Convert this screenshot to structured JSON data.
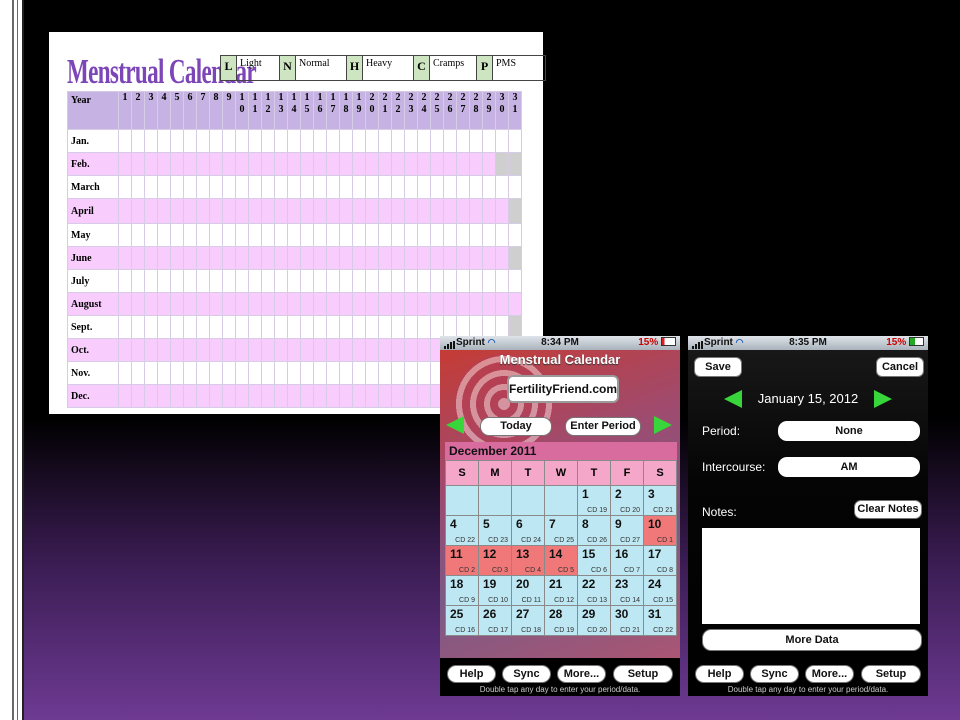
{
  "paper": {
    "title": "Menstrual Calendar",
    "legend": [
      {
        "code": "L",
        "label": "Light"
      },
      {
        "code": "N",
        "label": "Normal"
      },
      {
        "code": "H",
        "label": "Heavy"
      },
      {
        "code": "C",
        "label": "Cramps"
      },
      {
        "code": "P",
        "label": "PMS"
      }
    ],
    "year_label": "Year",
    "days": [
      "1",
      "2",
      "3",
      "4",
      "5",
      "6",
      "7",
      "8",
      "9",
      "1\n0",
      "1\n1",
      "1\n2",
      "1\n3",
      "1\n4",
      "1\n5",
      "1\n6",
      "1\n7",
      "1\n8",
      "1\n9",
      "2\n0",
      "2\n1",
      "2\n2",
      "2\n3",
      "2\n4",
      "2\n5",
      "2\n6",
      "2\n7",
      "2\n8",
      "2\n9",
      "3\n0",
      "3\n1"
    ],
    "months": [
      {
        "name": "Jan.",
        "shade": "white",
        "days_in_month": 31
      },
      {
        "name": "Feb.",
        "shade": "pink",
        "days_in_month": 29
      },
      {
        "name": "March",
        "shade": "white",
        "days_in_month": 31
      },
      {
        "name": "April",
        "shade": "pink",
        "days_in_month": 30
      },
      {
        "name": "May",
        "shade": "white",
        "days_in_month": 31
      },
      {
        "name": "June",
        "shade": "pink",
        "days_in_month": 30
      },
      {
        "name": "July",
        "shade": "white",
        "days_in_month": 31
      },
      {
        "name": "August",
        "shade": "pink",
        "days_in_month": 31
      },
      {
        "name": "Sept.",
        "shade": "white",
        "days_in_month": 30
      },
      {
        "name": "Oct.",
        "shade": "pink",
        "days_in_month": 31
      },
      {
        "name": "Nov.",
        "shade": "white",
        "days_in_month": 30
      },
      {
        "name": "Dec.",
        "shade": "pink",
        "days_in_month": 31
      }
    ]
  },
  "phone1": {
    "carrier": "Sprint",
    "time": "8:34 PM",
    "battery": "15%",
    "app_title": "Menstrual Calendar",
    "logo": "FertilityFriend.com",
    "today_label": "Today",
    "enter_period_label": "Enter Period",
    "month_title": "December 2011",
    "weekdays": [
      "S",
      "M",
      "T",
      "W",
      "T",
      "F",
      "S"
    ],
    "leading_blanks": 4,
    "days": [
      {
        "n": "1",
        "cd": "CD 19",
        "red": false
      },
      {
        "n": "2",
        "cd": "CD 20",
        "red": false
      },
      {
        "n": "3",
        "cd": "CD 21",
        "red": false
      },
      {
        "n": "4",
        "cd": "CD 22",
        "red": false
      },
      {
        "n": "5",
        "cd": "CD 23",
        "red": false
      },
      {
        "n": "6",
        "cd": "CD 24",
        "red": false
      },
      {
        "n": "7",
        "cd": "CD 25",
        "red": false
      },
      {
        "n": "8",
        "cd": "CD 26",
        "red": false
      },
      {
        "n": "9",
        "cd": "CD 27",
        "red": false
      },
      {
        "n": "10",
        "cd": "CD 1",
        "red": true
      },
      {
        "n": "11",
        "cd": "CD 2",
        "red": true
      },
      {
        "n": "12",
        "cd": "CD 3",
        "red": true
      },
      {
        "n": "13",
        "cd": "CD 4",
        "red": true
      },
      {
        "n": "14",
        "cd": "CD 5",
        "red": true
      },
      {
        "n": "15",
        "cd": "CD 6",
        "red": false
      },
      {
        "n": "16",
        "cd": "CD 7",
        "red": false
      },
      {
        "n": "17",
        "cd": "CD 8",
        "red": false
      },
      {
        "n": "18",
        "cd": "CD 9",
        "red": false
      },
      {
        "n": "19",
        "cd": "CD 10",
        "red": false
      },
      {
        "n": "20",
        "cd": "CD 11",
        "red": false
      },
      {
        "n": "21",
        "cd": "CD 12",
        "red": false
      },
      {
        "n": "22",
        "cd": "CD 13",
        "red": false
      },
      {
        "n": "23",
        "cd": "CD 14",
        "red": false
      },
      {
        "n": "24",
        "cd": "CD 15",
        "red": false
      },
      {
        "n": "25",
        "cd": "CD 16",
        "red": false
      },
      {
        "n": "26",
        "cd": "CD 17",
        "red": false
      },
      {
        "n": "27",
        "cd": "CD 18",
        "red": false
      },
      {
        "n": "28",
        "cd": "CD 19",
        "red": false
      },
      {
        "n": "29",
        "cd": "CD 20",
        "red": false
      },
      {
        "n": "30",
        "cd": "CD 21",
        "red": false
      },
      {
        "n": "31",
        "cd": "CD 22",
        "red": false
      }
    ],
    "tabs": [
      "Help",
      "Sync",
      "More...",
      "Setup"
    ],
    "hint": "Double tap any day to enter your period/data."
  },
  "phone2": {
    "carrier": "Sprint",
    "time": "8:35 PM",
    "battery": "15%",
    "save_label": "Save",
    "cancel_label": "Cancel",
    "date": "January 15, 2012",
    "period_label": "Period:",
    "period_value": "None",
    "intercourse_label": "Intercourse:",
    "intercourse_value": "AM",
    "notes_label": "Notes:",
    "clear_notes_label": "Clear Notes",
    "more_data_label": "More Data",
    "tabs": [
      "Help",
      "Sync",
      "More...",
      "Setup"
    ],
    "hint": "Double tap any day to enter your period/data."
  },
  "colors": {
    "accent_green": "#37d63a",
    "period_red": "#f07878",
    "cal_blue": "#bde7f2",
    "paper_pink": "#f8ccfc",
    "paper_header": "#c6b3e3"
  }
}
